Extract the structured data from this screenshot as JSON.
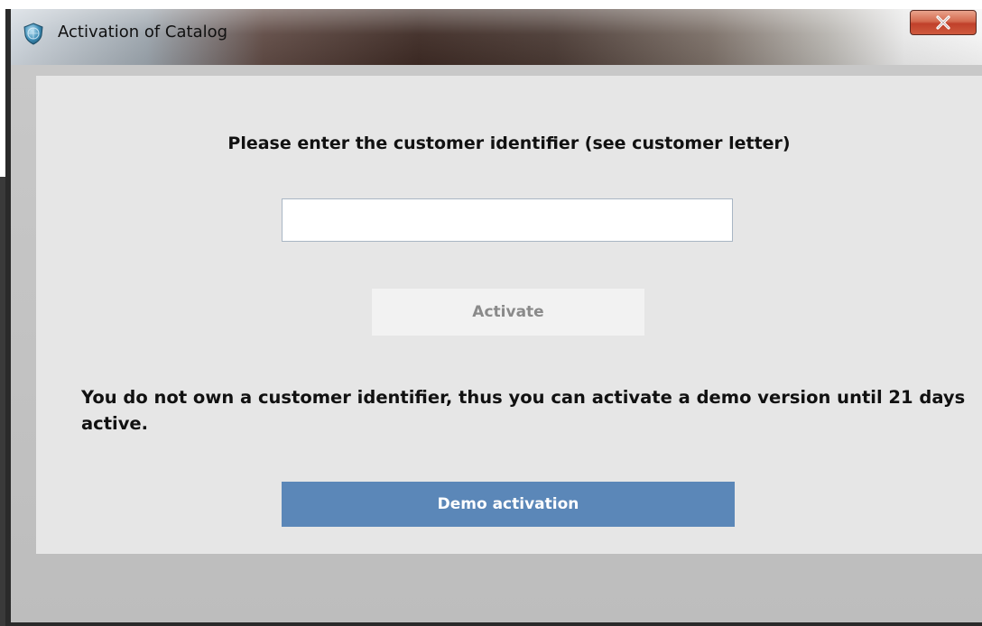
{
  "window": {
    "title": "Activation of Catalog",
    "close_symbol": "X"
  },
  "dialog": {
    "prompt": "Please enter the customer identifier (see customer letter)",
    "identifier_value": "",
    "activate_label": "Activate",
    "demo_note": "You do not own a customer identifier, thus you can activate a demo version until 21 days active.",
    "demo_button_label": "Demo activation"
  },
  "icons": {
    "app": "shield-globe-icon",
    "close": "close-icon"
  },
  "colors": {
    "demo_button": "#5b87b8",
    "activate_button_disabled": "#f2f2f2",
    "close_button": "#c0402a",
    "client_background": "#e6e6e6"
  }
}
